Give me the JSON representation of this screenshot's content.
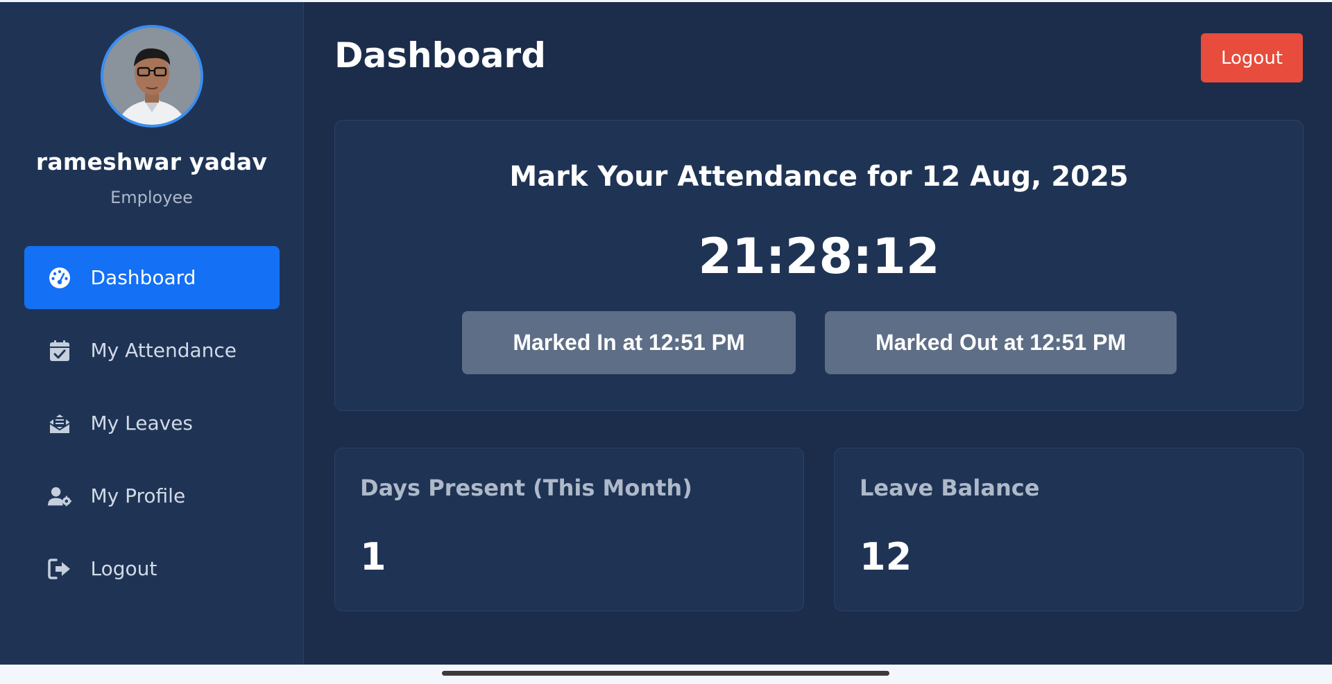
{
  "user": {
    "name": "rameshwar yadav",
    "role": "Employee"
  },
  "sidebar": {
    "items": [
      {
        "label": "Dashboard",
        "icon": "dashboard-gauge-icon",
        "active": true
      },
      {
        "label": "My Attendance",
        "icon": "calendar-check-icon",
        "active": false
      },
      {
        "label": "My Leaves",
        "icon": "envelope-open-text-icon",
        "active": false
      },
      {
        "label": "My Profile",
        "icon": "user-gear-icon",
        "active": false
      },
      {
        "label": "Logout",
        "icon": "sign-out-icon",
        "active": false
      }
    ]
  },
  "header": {
    "title": "Dashboard",
    "logout_label": "Logout"
  },
  "attendance": {
    "title": "Mark Your Attendance for 12 Aug, 2025",
    "clock": "21:28:12",
    "marked_in_label": "Marked In at 12:51 PM",
    "marked_out_label": "Marked Out at 12:51 PM"
  },
  "stats": [
    {
      "label": "Days Present (This Month)",
      "value": "1"
    },
    {
      "label": "Leave Balance",
      "value": "12"
    }
  ],
  "colors": {
    "background": "#1c2d4b",
    "sidebar": "#1f3455",
    "card": "#1f3455",
    "accent": "#1470f5",
    "danger": "#e74c3c",
    "button_muted": "#5e6e86"
  }
}
